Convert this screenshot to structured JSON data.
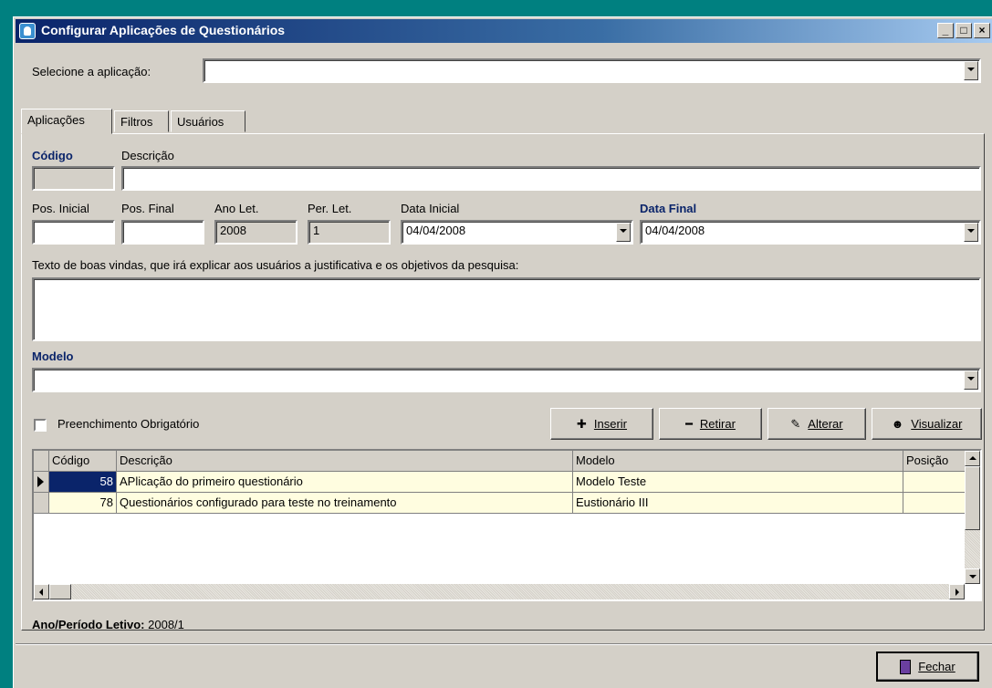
{
  "window": {
    "title": "Configurar Aplicações de Questionários",
    "minimize": "_",
    "maximize": "□",
    "close": "×"
  },
  "select_app": {
    "label": "Selecione a aplicação:",
    "value": ""
  },
  "tabs": [
    "Aplicações",
    "Filtros",
    "Usuários"
  ],
  "form": {
    "codigo_label": "Código",
    "descricao_label": "Descrição",
    "codigo_value": "",
    "descricao_value": "",
    "pos_inicial_label": "Pos. Inicial",
    "pos_final_label": "Pos. Final",
    "ano_let_label": "Ano Let.",
    "per_let_label": "Per. Let.",
    "data_inicial_label": "Data Inicial",
    "data_final_label": "Data Final",
    "pos_inicial_value": "",
    "pos_final_value": "",
    "ano_let_value": "2008",
    "per_let_value": "1",
    "data_inicial_value": "04/04/2008",
    "data_final_value": "04/04/2008",
    "texto_label": "Texto de boas vindas, que irá explicar aos usuários a justificativa e os objetivos da pesquisa:",
    "texto_value": "",
    "modelo_label": "Modelo",
    "modelo_value": "",
    "preenchimento_label": "Preenchimento Obrigatório"
  },
  "toolbar": {
    "inserir": "Inserir",
    "retirar": "Retirar",
    "alterar": "Alterar",
    "visualizar": "Visualizar"
  },
  "grid": {
    "columns": [
      "Código",
      "Descrição",
      "Modelo",
      "Posição"
    ],
    "rows": [
      {
        "codigo": "58",
        "descricao": "APlicação do primeiro questionário",
        "modelo": "Modelo Teste",
        "posicao": ""
      },
      {
        "codigo": "78",
        "descricao": "Questionários configurado para teste no treinamento",
        "modelo": "Eustionário III",
        "posicao": ""
      }
    ]
  },
  "footer": {
    "periodo_label": "Ano/Período Letivo:",
    "periodo_value": "2008/1",
    "fechar": "Fechar"
  },
  "colors": {
    "title_gradient_start": "#0a246a",
    "row_highlight": "#fffde0",
    "selected_cell": "#0a246a",
    "label_blue": "#0a246a"
  }
}
